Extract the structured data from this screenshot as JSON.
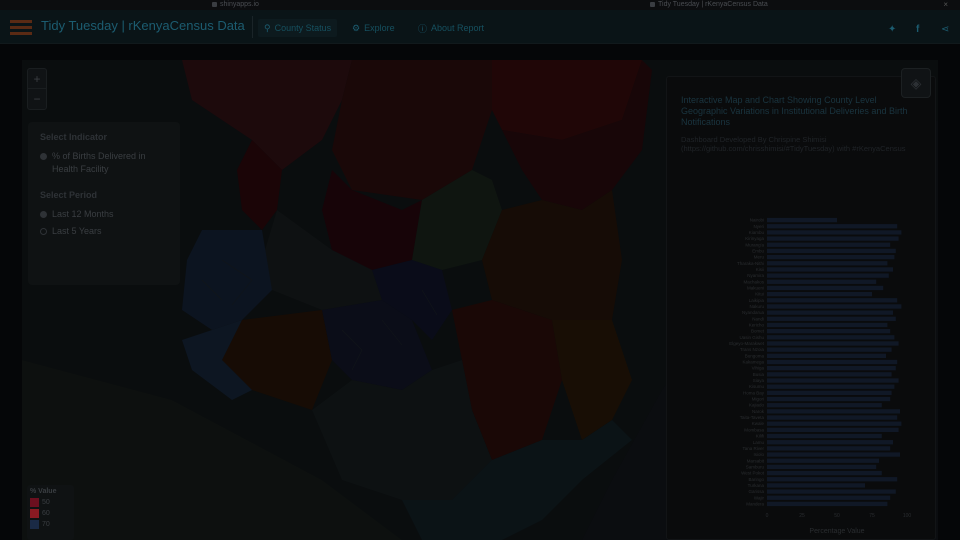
{
  "browser": {
    "tabs": [
      {
        "label": "shinyapps.io"
      },
      {
        "label": "Tidy Tuesday | rKenyaCensus Data"
      }
    ]
  },
  "app": {
    "title": "Tidy Tuesday | rKenyaCensus Data",
    "nav": [
      {
        "label": "County Status",
        "icon": "location-pin-icon",
        "active": true
      },
      {
        "label": "Explore",
        "icon": "gear-icon",
        "active": false
      },
      {
        "label": "About Report",
        "icon": "info-icon",
        "active": false
      }
    ],
    "social": [
      "twitter-icon",
      "facebook-icon",
      "share-icon"
    ]
  },
  "map": {
    "zoom_in": "+",
    "zoom_out": "−"
  },
  "indicator_panel": {
    "indicator_heading": "Select Indicator",
    "indicator_option": "% of Births Delivered in Health Facility",
    "period_heading": "Select Period",
    "period_options": [
      "Last 12 Months",
      "Last 5 Years"
    ],
    "selected_period": "Last 12 Months"
  },
  "legend": {
    "title": "% Value",
    "items": [
      {
        "label": "50",
        "color": "#6b0f1f"
      },
      {
        "label": "60",
        "color": "#8a1a22"
      },
      {
        "label": "70",
        "color": "#1a2a45"
      }
    ]
  },
  "chart_panel": {
    "title": "Interactive Map and Chart Showing County Level Geographic Variations in Institutional Deliveries and Birth Notifications",
    "subtitle": "Dashboard Developed By Chrispine Shimisi (https://github.com/chrisshimisi/#TidyTuesday) with #rKenyaCensus"
  },
  "chart_data": {
    "type": "bar",
    "orientation": "horizontal",
    "xlabel": "Percentage Value",
    "xlim": [
      0,
      100
    ],
    "x_ticks": [
      "0",
      "25",
      "50",
      "75",
      "100"
    ],
    "categories": [
      "Nairobi",
      "Nyeri",
      "Kiambu",
      "Kirinyaga",
      "Murang'a",
      "Embu",
      "Meru",
      "Tharaka-Nithi",
      "Kisii",
      "Nyamira",
      "Machakos",
      "Makueni",
      "Kitui",
      "Laikipia",
      "Nakuru",
      "Nyandarua",
      "Nandi",
      "Kericho",
      "Bomet",
      "Uasin Gishu",
      "Elgeyo-Marakwet",
      "Trans Nzoia",
      "Bungoma",
      "Kakamega",
      "Vihiga",
      "Busia",
      "Siaya",
      "Kisumu",
      "Homa Bay",
      "Migori",
      "Kajiado",
      "Narok",
      "Taita-Taveta",
      "Kwale",
      "Mombasa",
      "Kilifi",
      "Lamu",
      "Tana River",
      "Isiolo",
      "Marsabit",
      "Samburu",
      "West Pokot",
      "Baringo",
      "Turkana",
      "Garissa",
      "Wajir",
      "Mandera"
    ],
    "values": [
      50,
      93,
      96,
      94,
      88,
      92,
      91,
      86,
      90,
      87,
      78,
      83,
      75,
      93,
      96,
      90,
      92,
      86,
      88,
      91,
      94,
      89,
      85,
      93,
      92,
      89,
      94,
      91,
      89,
      88,
      82,
      95,
      93,
      96,
      94,
      82,
      90,
      88,
      95,
      80,
      78,
      82,
      93,
      70,
      92,
      88,
      86
    ]
  }
}
